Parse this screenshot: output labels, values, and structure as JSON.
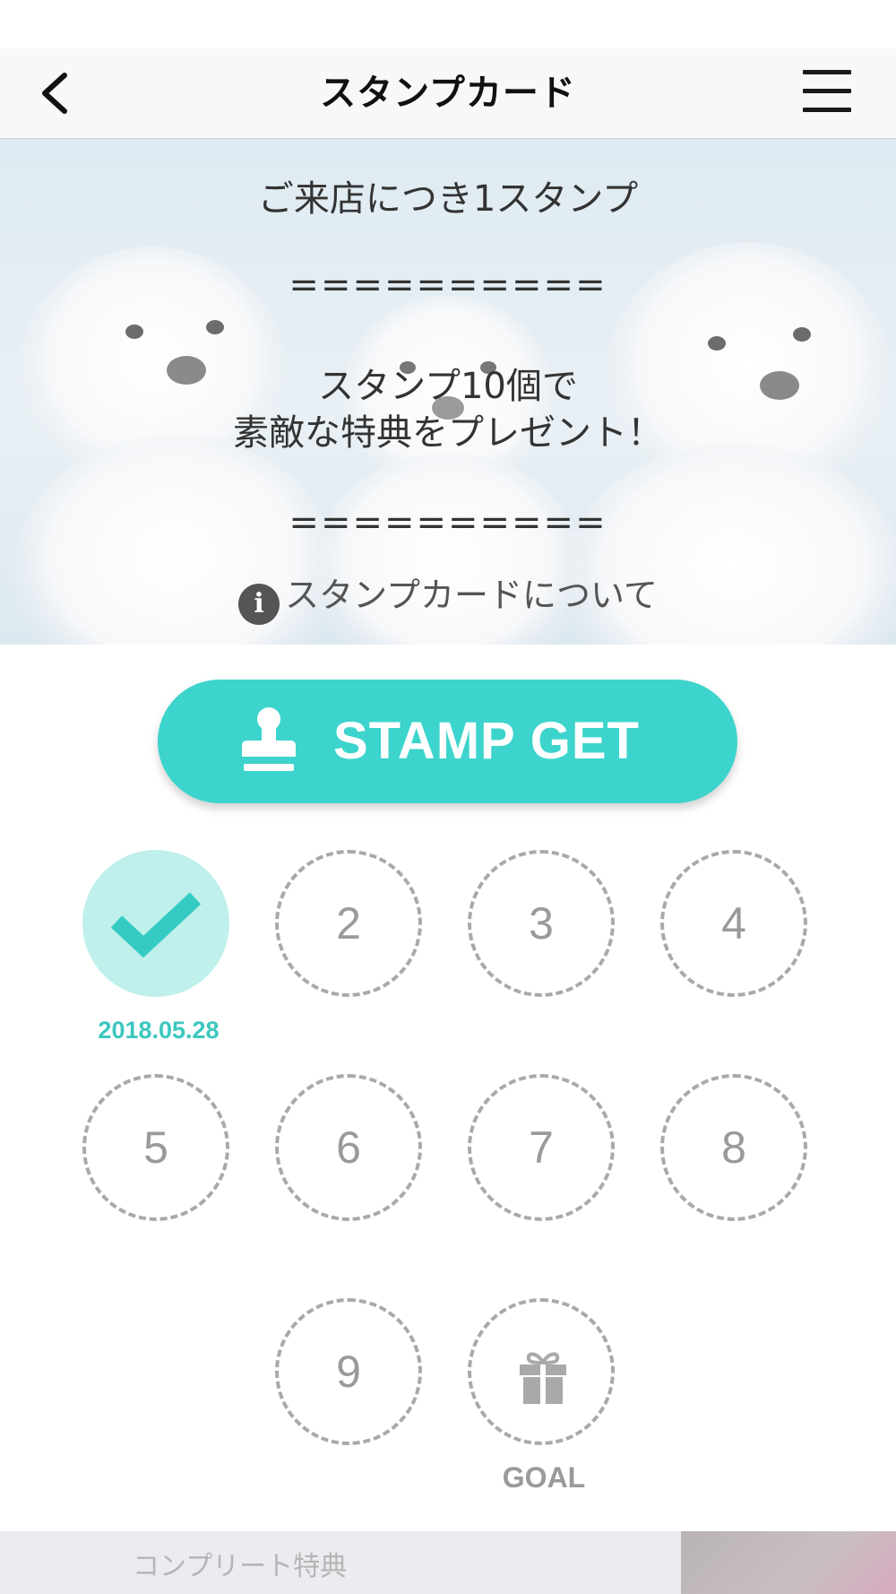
{
  "header": {
    "title": "スタンプカード",
    "back_icon": "chevron-left-icon",
    "menu_icon": "hamburger-menu-icon"
  },
  "hero": {
    "line1": "ご来店につき1スタンプ",
    "rule1": "==========",
    "line2a": "スタンプ10個で",
    "line2b": "素敵な特典をプレゼント！",
    "rule2": "==========",
    "about_link": "スタンプカードについて",
    "info_icon_glyph": "i"
  },
  "stamp_get": {
    "label": "STAMP GET",
    "icon": "stamp-icon",
    "color": "#3cd4cc"
  },
  "stamps": {
    "slots": [
      {
        "label": "",
        "stamped": true,
        "date": "2018.05.28"
      },
      {
        "label": "2",
        "stamped": false
      },
      {
        "label": "3",
        "stamped": false
      },
      {
        "label": "4",
        "stamped": false
      },
      {
        "label": "5",
        "stamped": false
      },
      {
        "label": "6",
        "stamped": false
      },
      {
        "label": "7",
        "stamped": false
      },
      {
        "label": "8",
        "stamped": false
      },
      {
        "label": "9",
        "stamped": false
      }
    ],
    "goal": {
      "label": "GOAL",
      "icon": "gift-icon"
    },
    "stamped_color": "#bff0ec",
    "check_color": "#35cbc3"
  },
  "bottom": {
    "complete_label": "コンプリート特典"
  }
}
